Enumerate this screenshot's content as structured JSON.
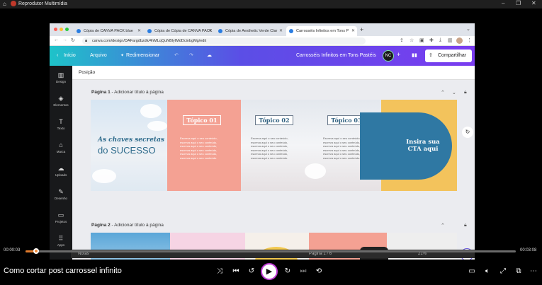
{
  "player": {
    "app_title": "Reprodutor Multimídia",
    "video_title": "Como cortar post carrossel infinito",
    "time_current": "00:00:03",
    "time_total": "00:03:08",
    "progress": 0.016
  },
  "browser": {
    "tabs": [
      {
        "label": "Cópia de CANVA PACK blue"
      },
      {
        "label": "Cópia de Cópia de CANVA PACK"
      },
      {
        "label": "Cópia de Aesthetic Verde Clar"
      },
      {
        "label": "Carrosséis Infinitos em Tons P"
      }
    ],
    "url": "canva.com/design/DAFargdbzdk/4hMLqQuNBlyIMdDcinbgMg/edit"
  },
  "canva": {
    "menu": {
      "home": "Início",
      "file": "Arquivo",
      "resize": "Redimensionar"
    },
    "design_title": "Carrosséis Infinitos em Tons Pastéis",
    "avatar": "NC",
    "share": "Compartilhar",
    "sidebar": [
      {
        "label": "Design",
        "icon": "layout-icon"
      },
      {
        "label": "Elementos",
        "icon": "shapes-icon"
      },
      {
        "label": "Texto",
        "icon": "text-icon"
      },
      {
        "label": "Marca",
        "icon": "brand-icon"
      },
      {
        "label": "Uploads",
        "icon": "upload-icon"
      },
      {
        "label": "Desenho",
        "icon": "draw-icon"
      },
      {
        "label": "Projetos",
        "icon": "folder-icon"
      },
      {
        "label": "Apps",
        "icon": "apps-icon"
      }
    ],
    "position_label": "Posição",
    "page1": {
      "label": "Página 1",
      "sub": "Adicionar título à página"
    },
    "page2": {
      "label": "Página 2",
      "sub": "Adicionar título à página"
    },
    "slide1": {
      "line1": "As chaves secretas",
      "line2": "do SUCESSO"
    },
    "topic1": "Tópico 01",
    "topic2": "Tópico 02",
    "topic3": "Tópico 03",
    "body_text": "Escreva aqui o seu conteúdo,\nescreva aqui o seu conteúdo,\nescreva aqui o seu conteúdo,\nescreva aqui o seu conteúdo,\nescreva aqui o seu conteúdo,\nescreva aqui o seu conteúdo.",
    "cta": "Insira sua CTA aqui",
    "status": {
      "notes": "Notas",
      "page": "Página 1 / 6",
      "zoom": "21%"
    }
  }
}
